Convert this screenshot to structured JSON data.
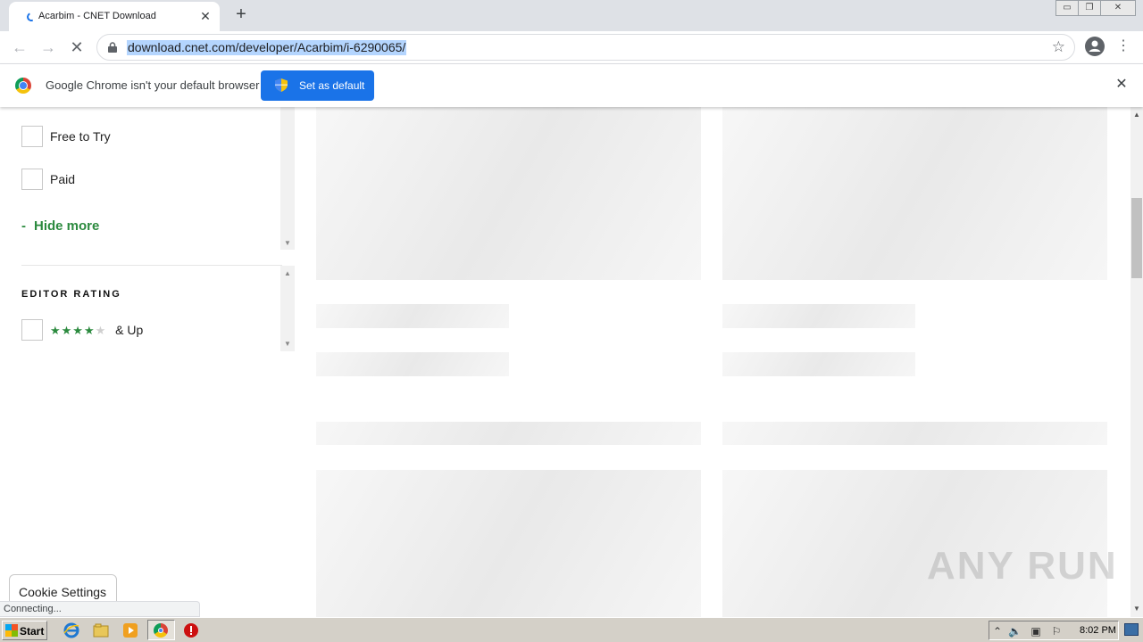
{
  "browser": {
    "tab_title": "Acarbim - CNET Download",
    "tab_close": "✕",
    "new_tab": "+",
    "back": "←",
    "forward": "→",
    "stop": "✕",
    "url": "download.cnet.com/developer/Acarbim/i-6290065/",
    "bookmark_star": "☆",
    "menu": "⋮",
    "window_minimize": "▭",
    "window_restore": "❐",
    "window_close": "✕"
  },
  "infobar": {
    "message": "Google Chrome isn't your default browser",
    "button_label": "Set as default",
    "close": "✕"
  },
  "sidebar": {
    "filters": [
      {
        "label": "Free to Try",
        "checked": false
      },
      {
        "label": "Paid",
        "checked": false
      }
    ],
    "hide_more_dash": "-",
    "hide_more": "Hide more",
    "editor_rating_title": "EDITOR RATING",
    "rating_stars_filled": "★★★★",
    "rating_stars_empty": "★",
    "rating_suffix": "& Up",
    "rating_value": 4,
    "accent_color": "#2b8a3e"
  },
  "cookie_settings": "Cookie Settings",
  "status": "Connecting...",
  "watermark": "ANY RUN",
  "taskbar": {
    "start": "Start",
    "clock": "8:02 PM",
    "icons": [
      "ie-icon",
      "folder-icon",
      "media-player-icon",
      "chrome-icon",
      "stop-sign-icon"
    ]
  }
}
